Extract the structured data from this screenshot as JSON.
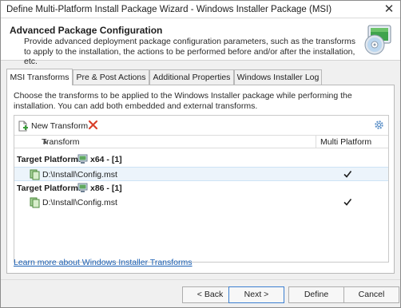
{
  "window": {
    "title": "Define Multi-Platform Install Package Wizard - Windows Installer Package (MSI)",
    "close_glyph": "✕"
  },
  "header": {
    "title": "Advanced Package Configuration",
    "description": "Provide advanced deployment package configuration parameters, such as the transforms to apply to the installation, the actions to be performed before and/or after the installation, etc.",
    "icon": "cd-package-icon"
  },
  "tabs": [
    {
      "label": "MSI Transforms",
      "active": true
    },
    {
      "label": "Pre & Post Actions",
      "active": false
    },
    {
      "label": "Additional Properties",
      "active": false
    },
    {
      "label": "Windows Installer Log",
      "active": false
    }
  ],
  "panel": {
    "description": "Choose the transforms to be applied to the Windows Installer package while performing the installation. You can add both embedded and external transforms."
  },
  "toolbar": {
    "new_transform_label": "New Transform",
    "delete_icon": "delete-x-icon",
    "settings_icon": "gear-icon"
  },
  "columns": {
    "transform": "Transform",
    "multi_platform": "Multi Platform",
    "sort_glyph": "▲"
  },
  "groups": [
    {
      "label": "Target Platform:",
      "value": "x64 - [1]",
      "rows": [
        {
          "path": "D:\\Install\\Config.mst",
          "multi_platform": true,
          "selected": true
        }
      ]
    },
    {
      "label": "Target Platform:",
      "value": "x86 - [1]",
      "rows": [
        {
          "path": "D:\\Install\\Config.mst",
          "multi_platform": true,
          "selected": false
        }
      ]
    }
  ],
  "link": "Learn more about Windows Installer Transforms",
  "buttons": {
    "back": "< Back",
    "next": "Next >",
    "define": "Define",
    "cancel": "Cancel"
  },
  "colors": {
    "accent": "#3c7fd0",
    "link": "#1a5fb4",
    "delete": "#d9402b",
    "selection": "#ecf4fb"
  }
}
